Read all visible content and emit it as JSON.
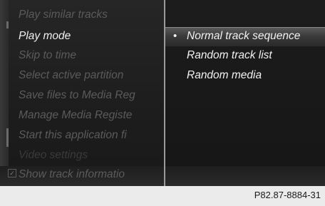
{
  "menu": {
    "items": [
      {
        "label": "Play similar tracks",
        "state": "disabled"
      },
      {
        "label": "Play mode",
        "state": "selected"
      },
      {
        "label": "Skip to time",
        "state": "disabled"
      },
      {
        "label": "Select active partition",
        "state": "disabled"
      },
      {
        "label": "Save files to Media Reg",
        "state": "disabled"
      },
      {
        "label": "Manage Media Registe",
        "state": "disabled"
      },
      {
        "label": "Start this application fi",
        "state": "disabled"
      },
      {
        "label": "Video settings",
        "state": "dim"
      },
      {
        "label": "Show track informatio",
        "state": "disabled",
        "checkbox": true
      }
    ]
  },
  "submenu": {
    "bullet": "•",
    "options": [
      {
        "label": "Normal track sequence",
        "selected": true
      },
      {
        "label": "Random track list",
        "selected": false
      },
      {
        "label": "Random media",
        "selected": false
      }
    ]
  },
  "caption": {
    "figure_code": "P82.87-8884-31"
  },
  "colors": {
    "active_text": "#f0f0f0",
    "disabled_text": "#5b5b5b",
    "highlight": "#5a5a5a",
    "divider": "#9a9a9a"
  }
}
